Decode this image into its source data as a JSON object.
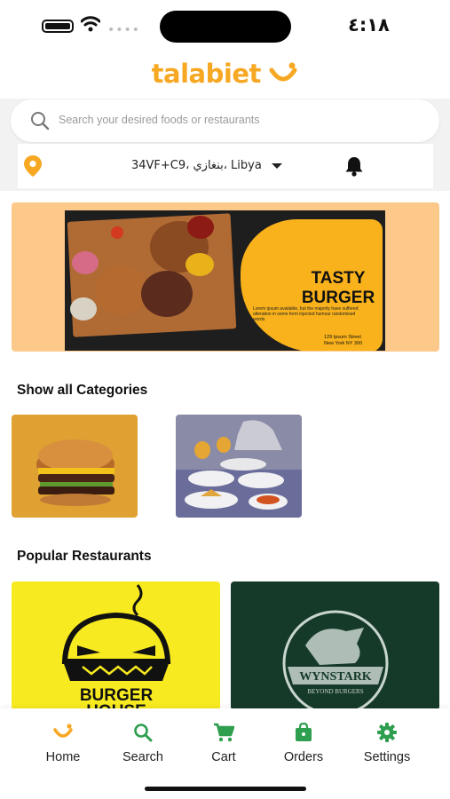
{
  "status_bar": {
    "time": "٤:١٨",
    "signal_dots": "••••"
  },
  "logo": {
    "text": "talabiet"
  },
  "search": {
    "placeholder": "Search your desired foods or restaurants"
  },
  "location": {
    "text": "34VF+C9، بنغازي، Libya"
  },
  "banner": {
    "headline_1": "TASTY",
    "headline_2": "BURGER",
    "body": "Lorem ipsum available, but the majority have suffered alteration in some form injected humour randomised words",
    "address_1": "129 Ipsum Street",
    "address_2": "New York NY 300"
  },
  "categories": {
    "title": "Show all Categories"
  },
  "restaurants": {
    "title": "Popular Restaurants",
    "items": [
      {
        "logo_text_1": "BURGER",
        "logo_text_2": "HOUSE"
      },
      {
        "logo_text_1": "WYNSTARK",
        "logo_text_2": "BEYOND BURGERS"
      }
    ]
  },
  "bottom_nav": {
    "items": [
      {
        "label": "Home",
        "icon": "home-smile-icon",
        "active": true
      },
      {
        "label": "Search",
        "icon": "search-icon"
      },
      {
        "label": "Cart",
        "icon": "cart-icon"
      },
      {
        "label": "Orders",
        "icon": "orders-bag-icon"
      },
      {
        "label": "Settings",
        "icon": "gear-icon"
      }
    ]
  },
  "colors": {
    "brand": "#f7a823",
    "nav_icon": "#2e9e4f",
    "banner_bg": "#fcc98a",
    "pin": "#f7a823"
  }
}
